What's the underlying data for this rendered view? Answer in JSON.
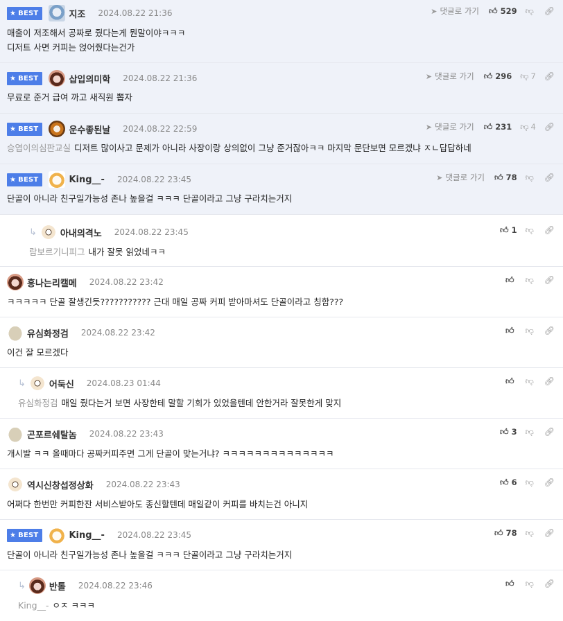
{
  "labels": {
    "best": "BEST",
    "reply_link": "댓글로 가기"
  },
  "icons": {
    "star": "star-icon",
    "thumbs_up": "thumbs-up-icon",
    "thumbs_down": "thumbs-down-icon",
    "share": "link-icon",
    "reply_arrow": "reply-arrow-icon",
    "send": "send-icon"
  },
  "colors": {
    "best_badge": "#4d7ee8",
    "best_row_bg": "#eff2f9"
  },
  "comments": [
    {
      "nick": "지조",
      "date": "2024.08.22 21:36",
      "mention": "",
      "text": "매출이 저조해서 공짜로 줬다는게 뭔말이야ㅋㅋㅋ",
      "text2": "디저트 사면 커피는 얹어줬다는건가",
      "likes": "529",
      "dislikes": ""
    },
    {
      "nick": "삽입의미학",
      "date": "2024.08.22 21:36",
      "mention": "",
      "text": "무료로 준거 급여 까고 새직원 뽑자",
      "likes": "296",
      "dislikes": "7"
    },
    {
      "nick": "운수좋된날",
      "date": "2024.08.22 22:59",
      "mention": "승엽이의심판교실",
      "text": "디저트 많이사고 문제가 아니라 사장이랑 상의없이 그냥 준거잖아ㅋㅋ 마지막 문단보면 모르겠냐 ㅈㄴ답답하네",
      "likes": "231",
      "dislikes": "4"
    },
    {
      "nick": "King__-",
      "date": "2024.08.22 23:45",
      "mention": "",
      "text": "단골이 아니라 친구일가능성 존나 높을걸 ㅋㅋㅋ 단골이라고 그냥 구라치는거지",
      "likes": "78",
      "dislikes": ""
    },
    {
      "nick": "아내의격노",
      "date": "2024.08.22 23:45",
      "mention": "람보르기니피그",
      "text": "내가 잘못 읽었네ㅋㅋ",
      "likes": "1",
      "dislikes": ""
    },
    {
      "nick": "흥나는리캘메",
      "date": "2024.08.22 23:42",
      "mention": "",
      "text": "ㅋㅋㅋㅋㅋ 단골 잘생긴듯??????????? 근대 매일 공짜 커피 받아마셔도 단골이라고 칭함???",
      "likes": "",
      "dislikes": ""
    },
    {
      "nick": "유심화정검",
      "date": "2024.08.22 23:42",
      "mention": "",
      "text": "이건 잘 모르겠다",
      "likes": "",
      "dislikes": ""
    },
    {
      "nick": "어둑신",
      "date": "2024.08.23 01:44",
      "mention": "유심화정검",
      "text": "매일 줬다는거 보면 사장한테 말할 기회가 있었을텐데 안한거라 잘못한게 맞지",
      "likes": "",
      "dislikes": ""
    },
    {
      "nick": "곤포르쉐탈놈",
      "date": "2024.08.22 23:43",
      "mention": "",
      "text": "개시발 ㅋㅋ 올때마다 공짜커피주면 그게 단골이 맞는거냐? ㅋㅋㅋㅋㅋㅋㅋㅋㅋㅋㅋㅋㅋㅋ",
      "likes": "3",
      "dislikes": ""
    },
    {
      "nick": "역시신창섭정상화",
      "date": "2024.08.22 23:43",
      "mention": "",
      "text": "어쩌다 한번만 커피한잔 서비스받아도 종신할텐데 매일같이 커피를 바치는건 아니지",
      "likes": "6",
      "dislikes": ""
    },
    {
      "nick": "King__-",
      "date": "2024.08.22 23:45",
      "mention": "",
      "text": "단골이 아니라 친구일가능성 존나 높을걸 ㅋㅋㅋ 단골이라고 그냥 구라치는거지",
      "likes": "78",
      "dislikes": ""
    },
    {
      "nick": "반톨",
      "date": "2024.08.22 23:46",
      "mention": "King__-",
      "text": "ㅇㅈ ㅋㅋㅋ",
      "likes": "",
      "dislikes": ""
    }
  ]
}
